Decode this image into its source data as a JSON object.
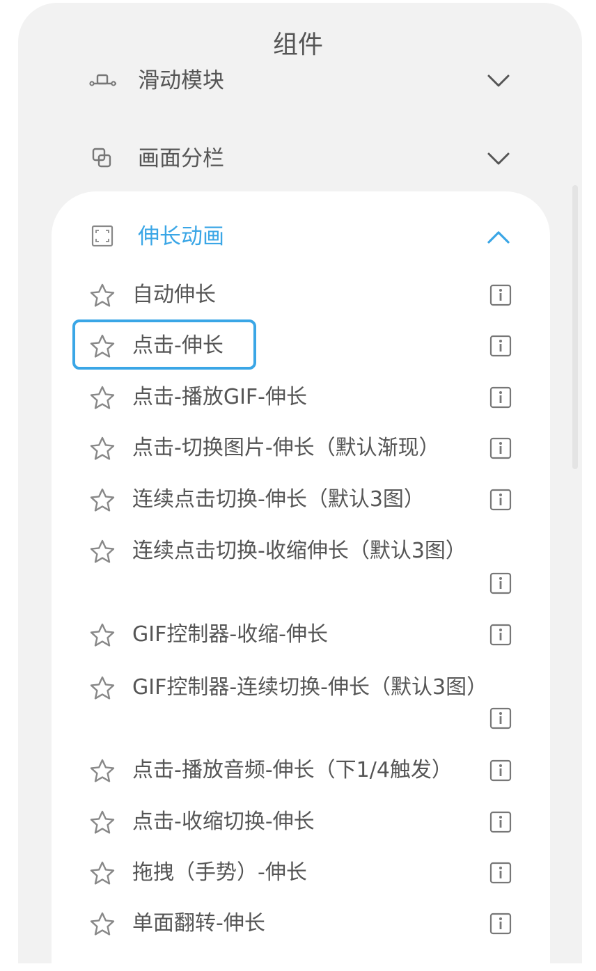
{
  "title": "组件",
  "accent_color": "#3aa6e6",
  "sections": [
    {
      "label": "滑动模块",
      "icon": "slider-icon",
      "expanded": false
    },
    {
      "label": "画面分栏",
      "icon": "split-screen-icon",
      "expanded": false
    },
    {
      "label": "伸长动画",
      "icon": "expand-icon",
      "expanded": true
    }
  ],
  "items": [
    {
      "label": "自动伸长"
    },
    {
      "label": "点击-伸长",
      "selected": true
    },
    {
      "label": "点击-播放GIF-伸长"
    },
    {
      "label": "点击-切换图片-伸长（默认渐现）"
    },
    {
      "label": "连续点击切换-伸长（默认3图）"
    },
    {
      "label": "连续点击切换-收缩伸长（默认3图）"
    },
    {
      "label": "GIF控制器-收缩-伸长"
    },
    {
      "label": "GIF控制器-连续切换-伸长（默认3图）"
    },
    {
      "label": "点击-播放音频-伸长（下1/4触发）"
    },
    {
      "label": "点击-收缩切换-伸长"
    },
    {
      "label": "拖拽（手势）-伸长"
    },
    {
      "label": "单面翻转-伸长"
    }
  ]
}
